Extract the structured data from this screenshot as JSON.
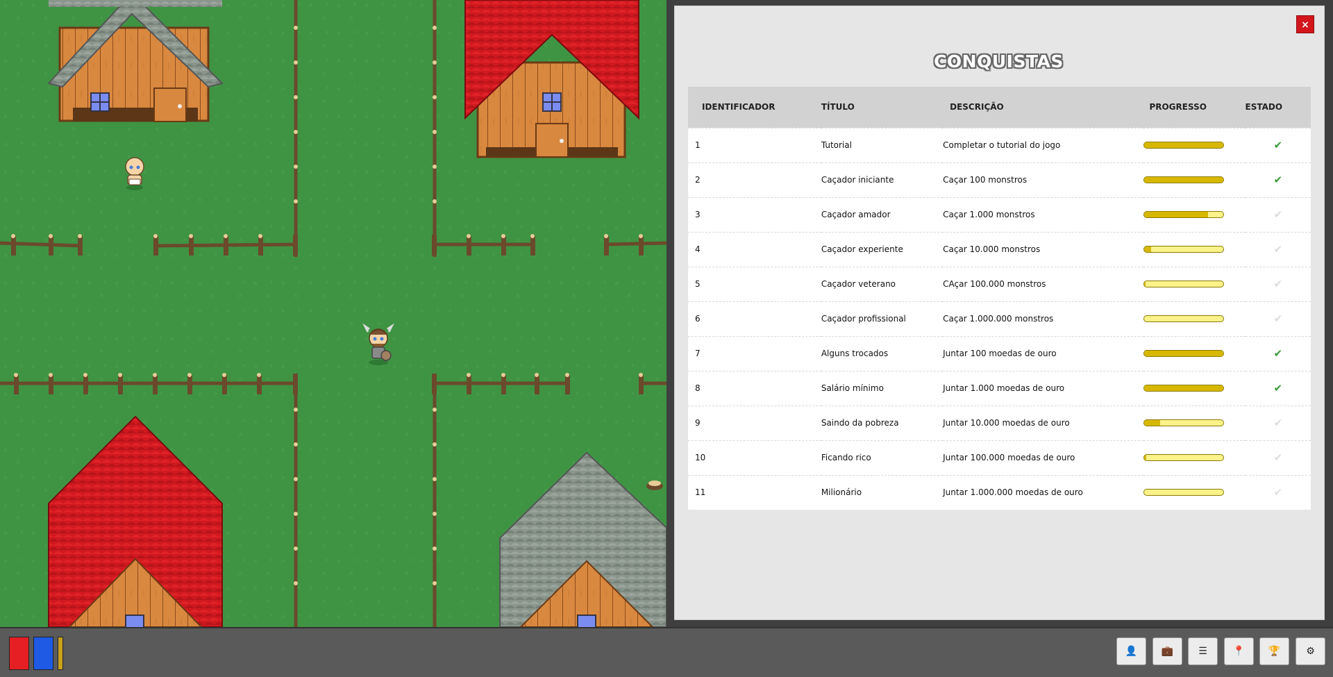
{
  "panel": {
    "title": "CONQUISTAS",
    "close_label": "×",
    "columns": [
      "IDENTIFICADOR",
      "TÍTULO",
      "DESCRIÇÃO",
      "PROGRESSO",
      "ESTADO"
    ],
    "rows": [
      {
        "id": "1",
        "title": "Tutorial",
        "description": "Completar o tutorial do jogo",
        "progress": 1.0,
        "done": true
      },
      {
        "id": "2",
        "title": "Caçador iniciante",
        "description": "Caçar 100 monstros",
        "progress": 1.0,
        "done": true
      },
      {
        "id": "3",
        "title": "Caçador amador",
        "description": "Caçar 1.000 monstros",
        "progress": 0.8,
        "done": false
      },
      {
        "id": "4",
        "title": "Caçador experiente",
        "description": "Caçar 10.000 monstros",
        "progress": 0.08,
        "done": false
      },
      {
        "id": "5",
        "title": "Caçador veterano",
        "description": "CAçar 100.000 monstros",
        "progress": 0.01,
        "done": false
      },
      {
        "id": "6",
        "title": "Caçador profissional",
        "description": "Caçar 1.000.000 monstros",
        "progress": 0.0,
        "done": false
      },
      {
        "id": "7",
        "title": "Alguns trocados",
        "description": "Juntar 100 moedas de ouro",
        "progress": 1.0,
        "done": true
      },
      {
        "id": "8",
        "title": "Salário mínimo",
        "description": "Juntar 1.000 moedas de ouro",
        "progress": 1.0,
        "done": true
      },
      {
        "id": "9",
        "title": "Saindo da pobreza",
        "description": "Juntar 10.000 moedas de ouro",
        "progress": 0.2,
        "done": false
      },
      {
        "id": "10",
        "title": "Ficando rico",
        "description": "Juntar 100.000 moedas de ouro",
        "progress": 0.02,
        "done": false
      },
      {
        "id": "11",
        "title": "Milionário",
        "description": "Juntar 1.000.000 moedas de ouro",
        "progress": 0.0,
        "done": false
      }
    ],
    "check_glyph": "✔",
    "colors": {
      "done": "#3a9a3a",
      "pending": "#dcdcdc",
      "bar_fill": "#d7b800",
      "bar_empty": "#fbf38a"
    }
  },
  "hud": {
    "health": 1.0,
    "mana": 1.0,
    "experience": 1.0,
    "colors": {
      "health": "#e51f24",
      "mana": "#1f5ae5",
      "experience": "#c9a11c"
    }
  },
  "toolbar": [
    {
      "name": "character-button",
      "icon": "person-icon",
      "glyph": "👤"
    },
    {
      "name": "inventory-button",
      "icon": "briefcase-icon",
      "glyph": "💼"
    },
    {
      "name": "quests-button",
      "icon": "list-icon",
      "glyph": "☰"
    },
    {
      "name": "map-button",
      "icon": "map-pin-icon",
      "glyph": "📍"
    },
    {
      "name": "achievements-button",
      "icon": "trophy-icon",
      "glyph": "🏆"
    },
    {
      "name": "settings-button",
      "icon": "gear-icon",
      "glyph": "⚙"
    }
  ]
}
